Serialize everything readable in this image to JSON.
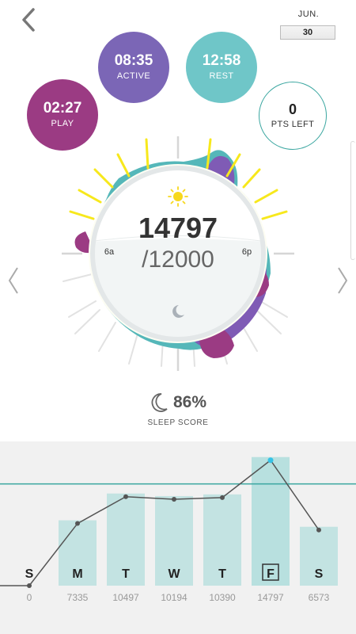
{
  "date": {
    "month": "JUN.",
    "day": "30"
  },
  "stats": {
    "active": {
      "value": "08:35",
      "label": "ACTIVE"
    },
    "rest": {
      "value": "12:58",
      "label": "REST"
    },
    "play": {
      "value": "02:27",
      "label": "PLAY"
    },
    "points": {
      "value": "0",
      "label": "PTS LEFT"
    }
  },
  "dial": {
    "steps": "14797",
    "goal": "/12000",
    "morning_label": "6a",
    "evening_label": "6p"
  },
  "sleep": {
    "score": "86%",
    "label": "SLEEP SCORE"
  },
  "colors": {
    "active": "#7b66b6",
    "rest": "#6fc6c8",
    "play": "#9b3b83",
    "teal": "#3aa6a0",
    "sun_rays": "#f7e81c",
    "highlight": "#34c2e6"
  },
  "icons": [
    "back-chevron-icon",
    "sun-icon",
    "moon-icon",
    "crescent-moon-icon",
    "previous-chevron-icon",
    "next-chevron-icon"
  ],
  "chart_data": {
    "type": "bar",
    "categories": [
      "S",
      "M",
      "T",
      "W",
      "T",
      "F",
      "S"
    ],
    "values": [
      0,
      7335,
      10497,
      10194,
      10390,
      14797,
      6573
    ],
    "value_labels": [
      "0",
      "7335",
      "10497",
      "10194",
      "10390",
      "14797",
      "6573"
    ],
    "selected_index": 5,
    "goal": 12000,
    "ylim": [
      0,
      15800
    ],
    "overlay": "line"
  }
}
